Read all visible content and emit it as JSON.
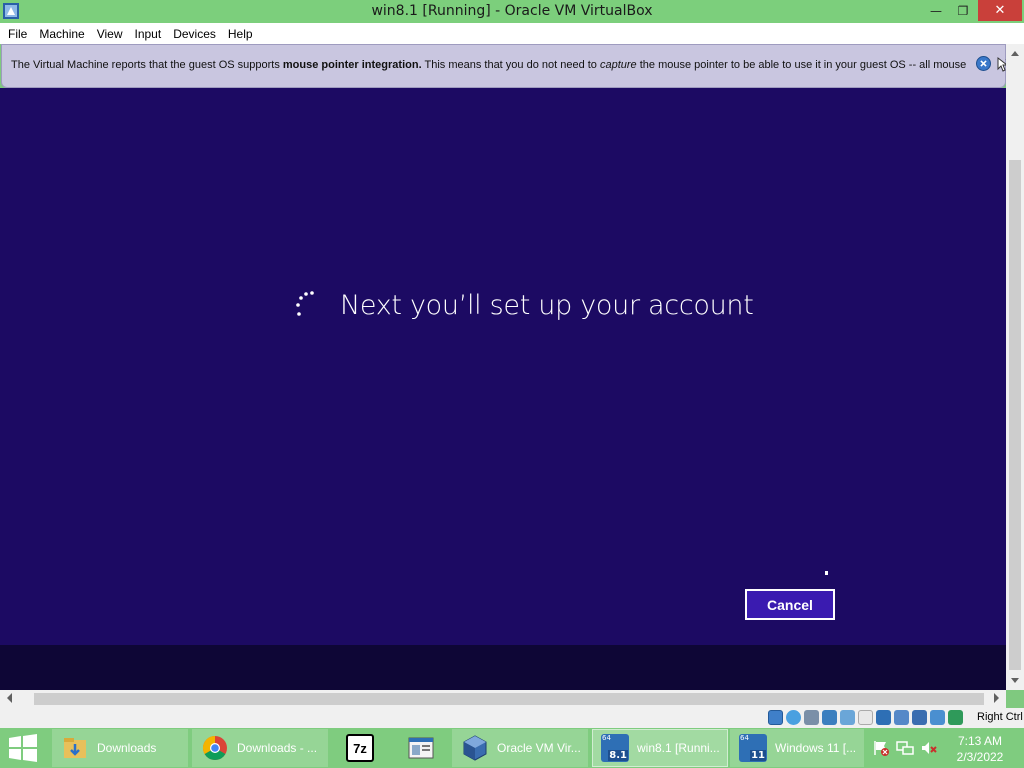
{
  "window": {
    "title": "win8.1 [Running] - Oracle VM VirtualBox",
    "minimize_glyph": "—",
    "maximize_glyph": "❐",
    "close_glyph": "✕"
  },
  "menu": [
    "File",
    "Machine",
    "View",
    "Input",
    "Devices",
    "Help"
  ],
  "notice": {
    "text_before": "The Virtual Machine reports that the guest OS supports ",
    "bold": "mouse pointer integration.",
    "text_middle": " This means that you do not need to ",
    "italic": "capture",
    "text_after": " the mouse pointer to be able to use it in your guest OS -- all mouse"
  },
  "guest": {
    "setup_title": "Next you’ll set up your account",
    "cancel_label": "Cancel"
  },
  "statusbar": {
    "host_key": "Right Ctrl"
  },
  "taskbar": {
    "tasks": [
      {
        "label": "Downloads",
        "icon": "folder-icon"
      },
      {
        "label": "Downloads - ...",
        "icon": "chrome-icon"
      },
      {
        "label": "",
        "icon": "7zip-icon"
      },
      {
        "label": "",
        "icon": "document-viewer-icon"
      },
      {
        "label": "Oracle VM Vir...",
        "icon": "virtualbox-icon"
      },
      {
        "label": "win8.1 [Runni...",
        "icon": "vm-win81-icon"
      },
      {
        "label": "Windows 11 [...",
        "icon": "vm-win11-icon"
      }
    ],
    "seven_zip_text": "7z",
    "vm81_badge": "8.1",
    "vm11_badge": "11",
    "vm_bits": "64",
    "time": "7:13 AM",
    "date": "2/3/2022"
  },
  "colors": {
    "guest_bg": "#1c0a63",
    "cancel_bg": "#3a1bb0",
    "taskbar_bg": "#7fcc7f",
    "notice_bg": "#c9c6e0"
  }
}
